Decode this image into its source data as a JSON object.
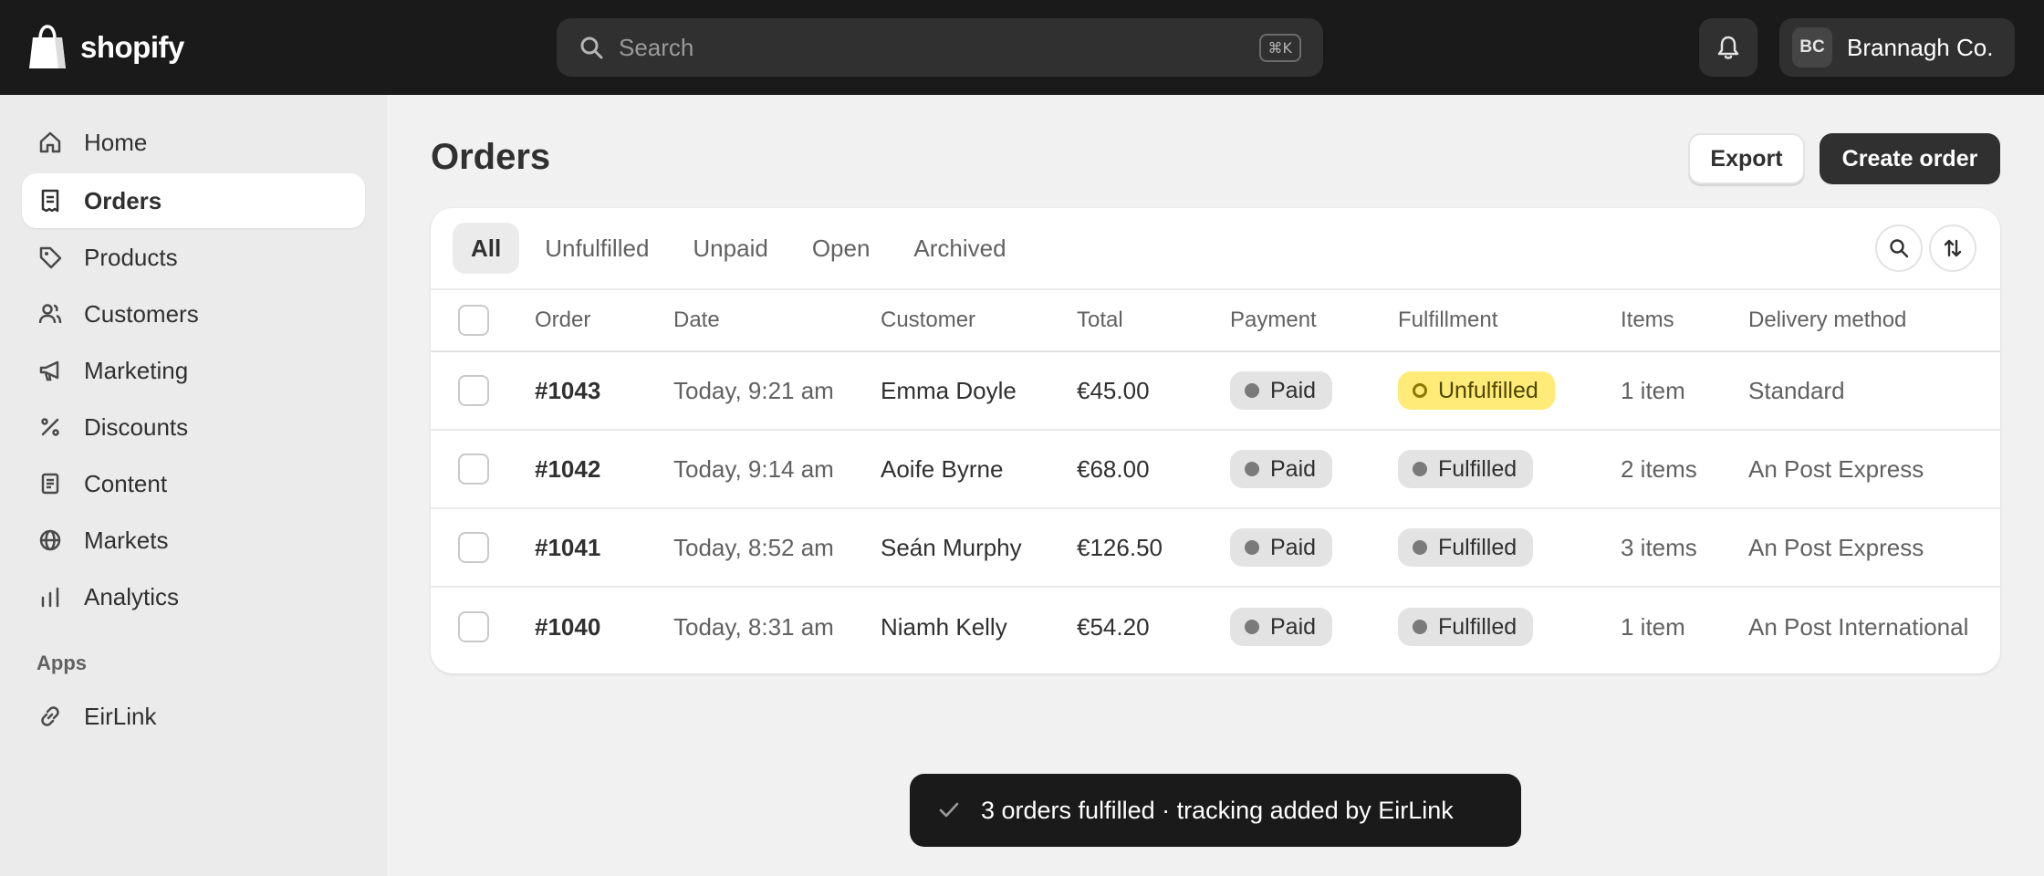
{
  "topbar": {
    "brand": "shopify",
    "search_placeholder": "Search",
    "search_shortcut": "⌘K",
    "account_initials": "BC",
    "account_name": "Brannagh Co."
  },
  "sidebar": {
    "items": [
      {
        "label": "Home",
        "icon": "home-icon"
      },
      {
        "label": "Orders",
        "icon": "orders-icon",
        "active": true
      },
      {
        "label": "Products",
        "icon": "tag-icon"
      },
      {
        "label": "Customers",
        "icon": "customers-icon"
      },
      {
        "label": "Marketing",
        "icon": "megaphone-icon"
      },
      {
        "label": "Discounts",
        "icon": "percent-icon"
      },
      {
        "label": "Content",
        "icon": "document-icon"
      },
      {
        "label": "Markets",
        "icon": "globe-icon"
      },
      {
        "label": "Analytics",
        "icon": "bar-chart-icon"
      }
    ],
    "apps_heading": "Apps",
    "apps": [
      {
        "label": "EirLink",
        "icon": "link-icon"
      }
    ]
  },
  "page": {
    "title": "Orders",
    "export_label": "Export",
    "create_label": "Create order"
  },
  "tabs": [
    {
      "label": "All",
      "active": true
    },
    {
      "label": "Unfulfilled"
    },
    {
      "label": "Unpaid"
    },
    {
      "label": "Open"
    },
    {
      "label": "Archived"
    }
  ],
  "table": {
    "columns": [
      "Order",
      "Date",
      "Customer",
      "Total",
      "Payment",
      "Fulfillment",
      "Items",
      "Delivery method"
    ],
    "rows": [
      {
        "order": "#1043",
        "date": "Today, 9:21 am",
        "customer": "Emma Doyle",
        "total": "€45.00",
        "payment": "Paid",
        "fulfillment": "Unfulfilled",
        "items": "1 item",
        "delivery": "Standard"
      },
      {
        "order": "#1042",
        "date": "Today, 9:14 am",
        "customer": "Aoife Byrne",
        "total": "€68.00",
        "payment": "Paid",
        "fulfillment": "Fulfilled",
        "items": "2 items",
        "delivery": "An Post Express"
      },
      {
        "order": "#1041",
        "date": "Today, 8:52 am",
        "customer": "Seán Murphy",
        "total": "€126.50",
        "payment": "Paid",
        "fulfillment": "Fulfilled",
        "items": "3 items",
        "delivery": "An Post Express"
      },
      {
        "order": "#1040",
        "date": "Today, 8:31 am",
        "customer": "Niamh Kelly",
        "total": "€54.20",
        "payment": "Paid",
        "fulfillment": "Fulfilled",
        "items": "1 item",
        "delivery": "An Post International"
      }
    ]
  },
  "toast": {
    "message": "3 orders fulfilled · tracking added by EirLink"
  },
  "colors": {
    "topbar": "#1a1a1a",
    "primary_button": "#303030",
    "unfulfilled_badge": "#ffeb78",
    "neutral_badge": "#e3e3e3"
  }
}
